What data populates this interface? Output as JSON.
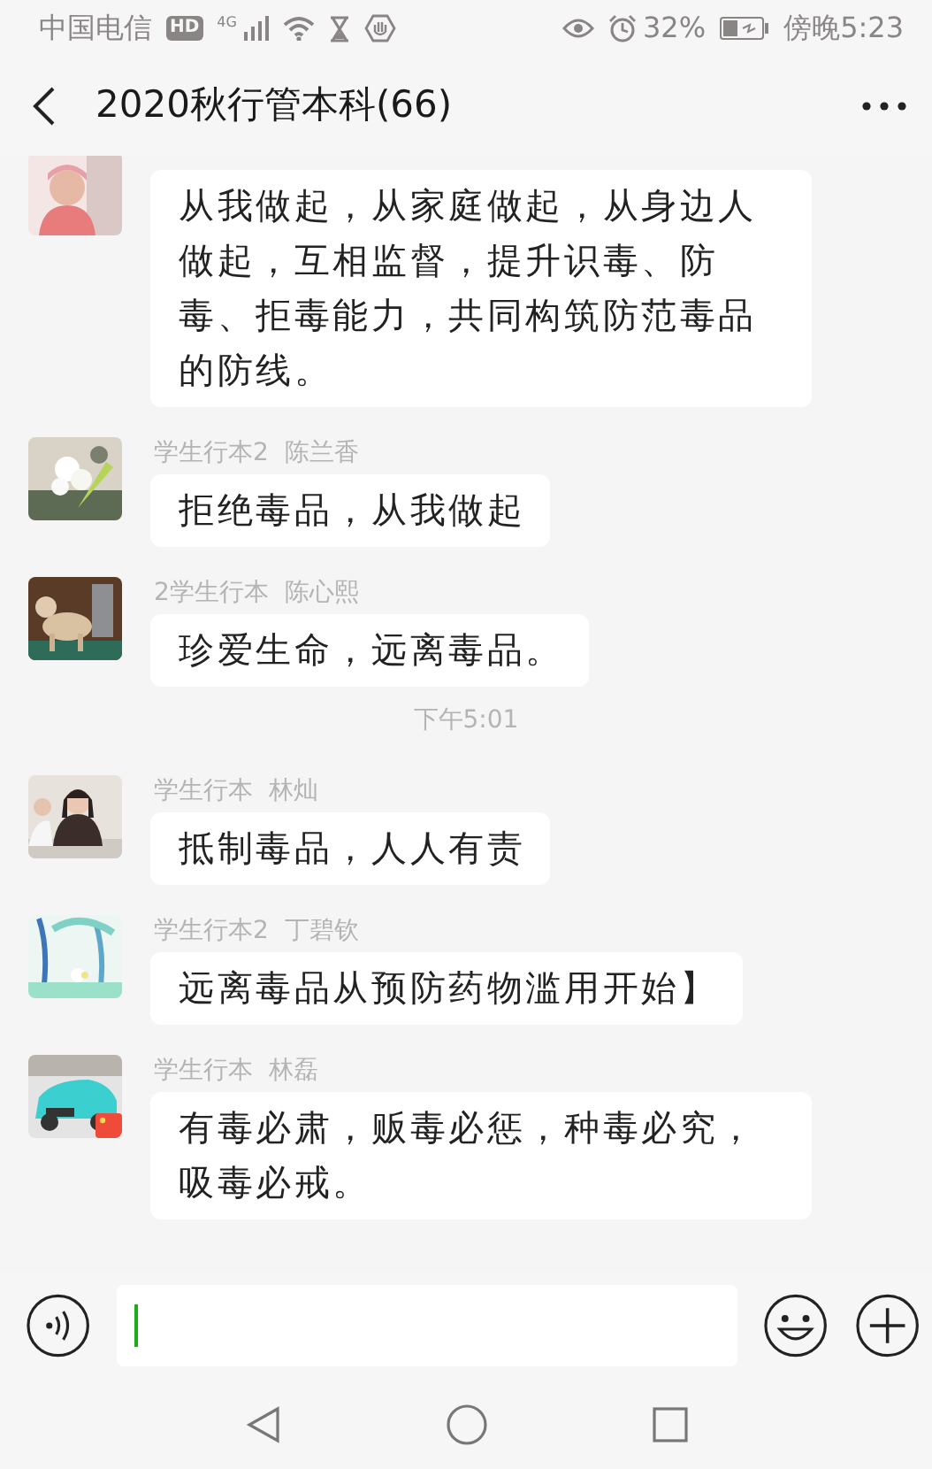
{
  "status_bar": {
    "carrier": "中国电信",
    "hd": "HD",
    "network": "4G",
    "battery": "32%",
    "time": "傍晚5:23"
  },
  "header": {
    "title": "2020秋行管本科(66)"
  },
  "messages": [
    {
      "kind": "message",
      "text": "从我做起，从家庭做起，从身边人做起，互相监督，提升识毒、防毒、拒毒能力，共同构筑防范毒品的防线。"
    },
    {
      "kind": "message",
      "sender": "学生行本2  陈兰香",
      "text": "拒绝毒品，从我做起"
    },
    {
      "kind": "message",
      "sender": "2学生行本  陈心熙",
      "text": "珍爱生命，远离毒品。"
    },
    {
      "kind": "time",
      "text": "下午5:01"
    },
    {
      "kind": "message",
      "sender": "学生行本  林灿",
      "text": "抵制毒品，人人有责"
    },
    {
      "kind": "message",
      "sender": "学生行本2  丁碧钦",
      "text": "远离毒品从预防药物滥用开始】"
    },
    {
      "kind": "message",
      "sender": "学生行本  林磊",
      "text": "有毒必肃，贩毒必惩，种毒必究，吸毒必戒。"
    }
  ]
}
